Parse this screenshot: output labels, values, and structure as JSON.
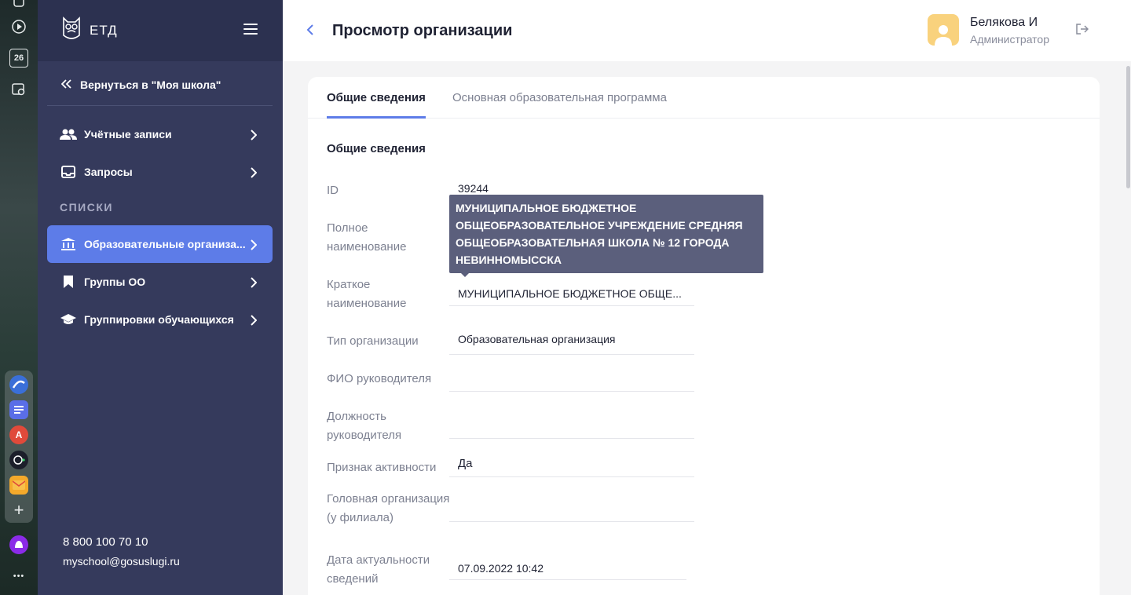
{
  "browser": {
    "icons": [
      "toggle-icon",
      "play-icon",
      "calendar-icon",
      "screenshot-icon"
    ],
    "calendar_day": "26",
    "more": "•••"
  },
  "sidebar": {
    "logo": "ЕТД",
    "back_link": "Вернуться в \"Моя школа\"",
    "items": [
      {
        "label": "Учётные записи",
        "icon": "users-icon"
      },
      {
        "label": "Запросы",
        "icon": "inbox-icon"
      }
    ],
    "section": "СПИСКИ",
    "list_items": [
      {
        "label": "Образовательные организа...",
        "icon": "building-icon",
        "active": true
      },
      {
        "label": "Группы ОО",
        "icon": "bookmark-icon"
      },
      {
        "label": "Группировки обучающихся",
        "icon": "graduation-cap-icon"
      }
    ],
    "phone": "8 800 100 70 10",
    "email": "myschool@gosuslugi.ru"
  },
  "header": {
    "title": "Просмотр организации",
    "user_name": "Белякова И",
    "user_role": "Администратор"
  },
  "tabs": [
    "Общие сведения",
    "Основная образовательная программа"
  ],
  "section_title": "Общие сведения",
  "fields": [
    {
      "label": "ID",
      "value": "39244"
    },
    {
      "label": "Полное наименование",
      "value": ""
    },
    {
      "label": "Краткое наименование",
      "value": "МУНИЦИПАЛЬНОЕ БЮДЖЕТНОЕ ОБЩЕ..."
    },
    {
      "label": "Тип организации",
      "value": "Образовательная организация"
    },
    {
      "label": "ФИО руководителя",
      "value": ""
    },
    {
      "label": "Должность руководителя",
      "value": ""
    },
    {
      "label": "Признак активности",
      "value": "Да"
    },
    {
      "label": "Головная организация (у филиала)",
      "value": ""
    },
    {
      "label": "Дата актуальности сведений",
      "value": "07.09.2022 10:42"
    }
  ],
  "tooltip": "МУНИЦИПАЛЬНОЕ БЮДЖЕТНОЕ ОБЩЕОБРАЗОВАТЕЛЬНОЕ УЧРЕЖДЕНИЕ СРЕДНЯЯ ОБЩЕОБРАЗОВАТЕЛЬНАЯ ШКОЛА № 12 ГОРОДА НЕВИННОМЫССКА",
  "colors": {
    "accent": "#5d7ce8",
    "sidebar": "#353a5c",
    "tooltip": "#5b5f7c"
  }
}
